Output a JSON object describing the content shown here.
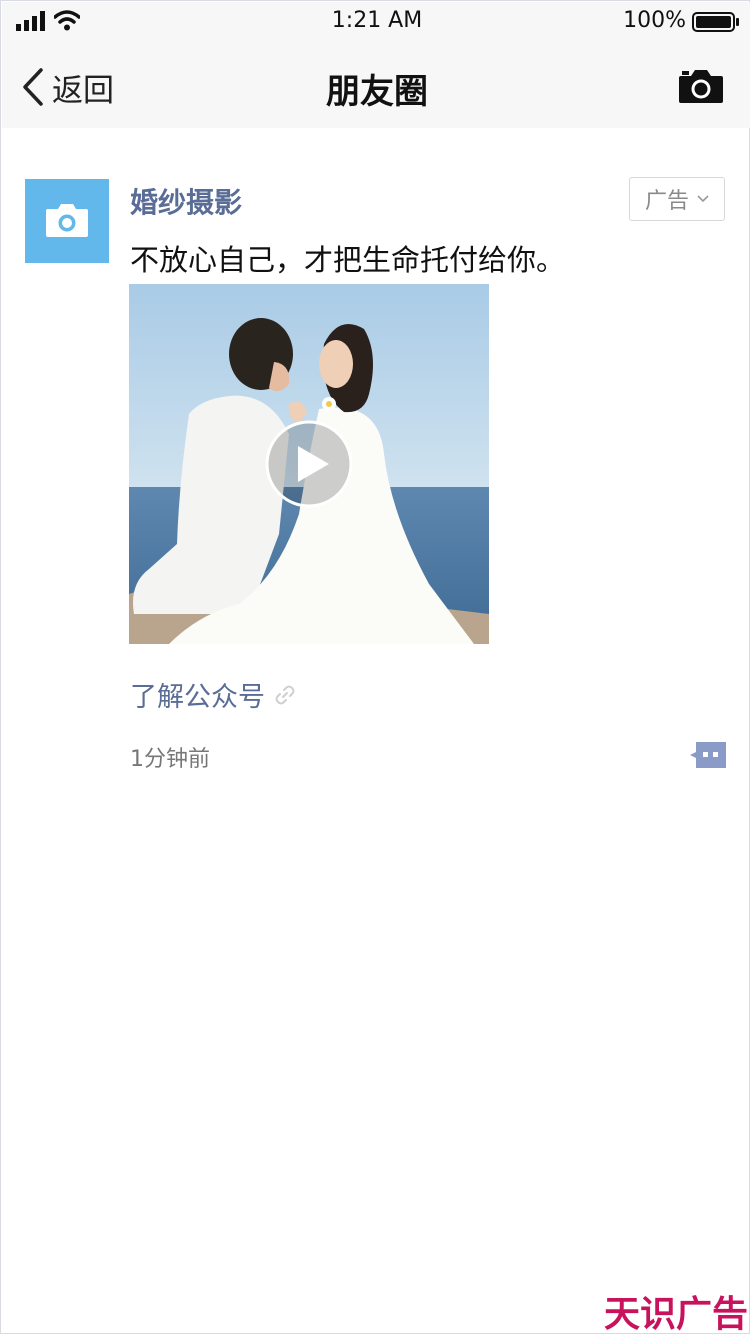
{
  "status_bar": {
    "time": "1:21 AM",
    "battery": "100%",
    "icons": [
      "signal-icon",
      "wifi-icon",
      "battery-icon"
    ]
  },
  "nav": {
    "back_label": "返回",
    "title": "朋友圈",
    "icons": [
      "back-chevron-icon",
      "camera-icon"
    ]
  },
  "post": {
    "author": "婚纱摄影",
    "ad_label": "广告",
    "text": "不放心自己，才把生命托付给你。",
    "link_label": "了解公众号",
    "timestamp": "1分钟前",
    "media": "video",
    "icons": [
      "avatar-camera-icon",
      "chevron-down-icon",
      "play-icon",
      "link-icon",
      "comment-icon"
    ]
  },
  "watermark": {
    "text": "天识广告"
  },
  "colors": {
    "accent_link": "#5a6d96",
    "avatar_bg": "#62b8ea",
    "nav_bg": "#f7f7f7",
    "watermark": "#c8125c"
  }
}
